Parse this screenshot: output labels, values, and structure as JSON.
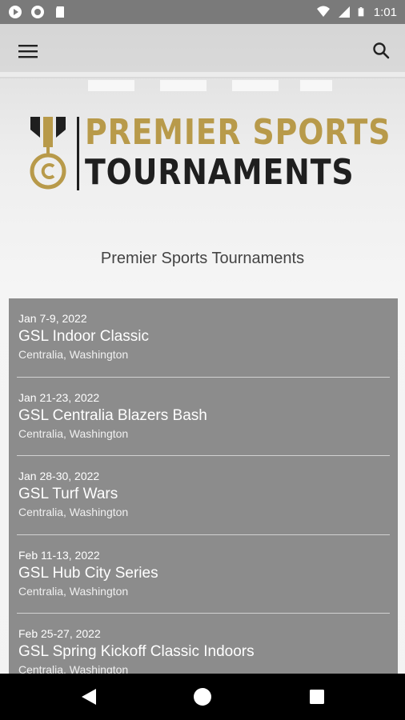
{
  "status_bar": {
    "time": "1:01",
    "icons": [
      "play-store-icon",
      "circle-notification-icon",
      "sd-card-icon",
      "wifi-icon",
      "signal-icon",
      "battery-icon"
    ]
  },
  "app_bar": {
    "menu_icon": "hamburger-menu-icon",
    "search_icon": "search-icon"
  },
  "logo": {
    "line1": "PREMIER SPORTS",
    "line2": "TOURNAMENTS",
    "gold": "#b89a4a",
    "dark": "#1f1f1f"
  },
  "page_title": "Premier Sports Tournaments",
  "events": [
    {
      "date": "Jan 7-9, 2022",
      "name": "GSL Indoor Classic",
      "location": "Centralia, Washington"
    },
    {
      "date": "Jan 21-23, 2022",
      "name": "GSL Centralia Blazers Bash",
      "location": "Centralia, Washington"
    },
    {
      "date": "Jan 28-30, 2022",
      "name": "GSL Turf Wars",
      "location": "Centralia, Washington"
    },
    {
      "date": "Feb 11-13, 2022",
      "name": "GSL Hub City Series",
      "location": "Centralia, Washington"
    },
    {
      "date": "Feb 25-27, 2022",
      "name": "GSL Spring Kickoff Classic Indoors",
      "location": "Centralia, Washington"
    }
  ],
  "nav_bar": {
    "icons": [
      "back-icon",
      "home-icon",
      "recents-icon"
    ]
  }
}
